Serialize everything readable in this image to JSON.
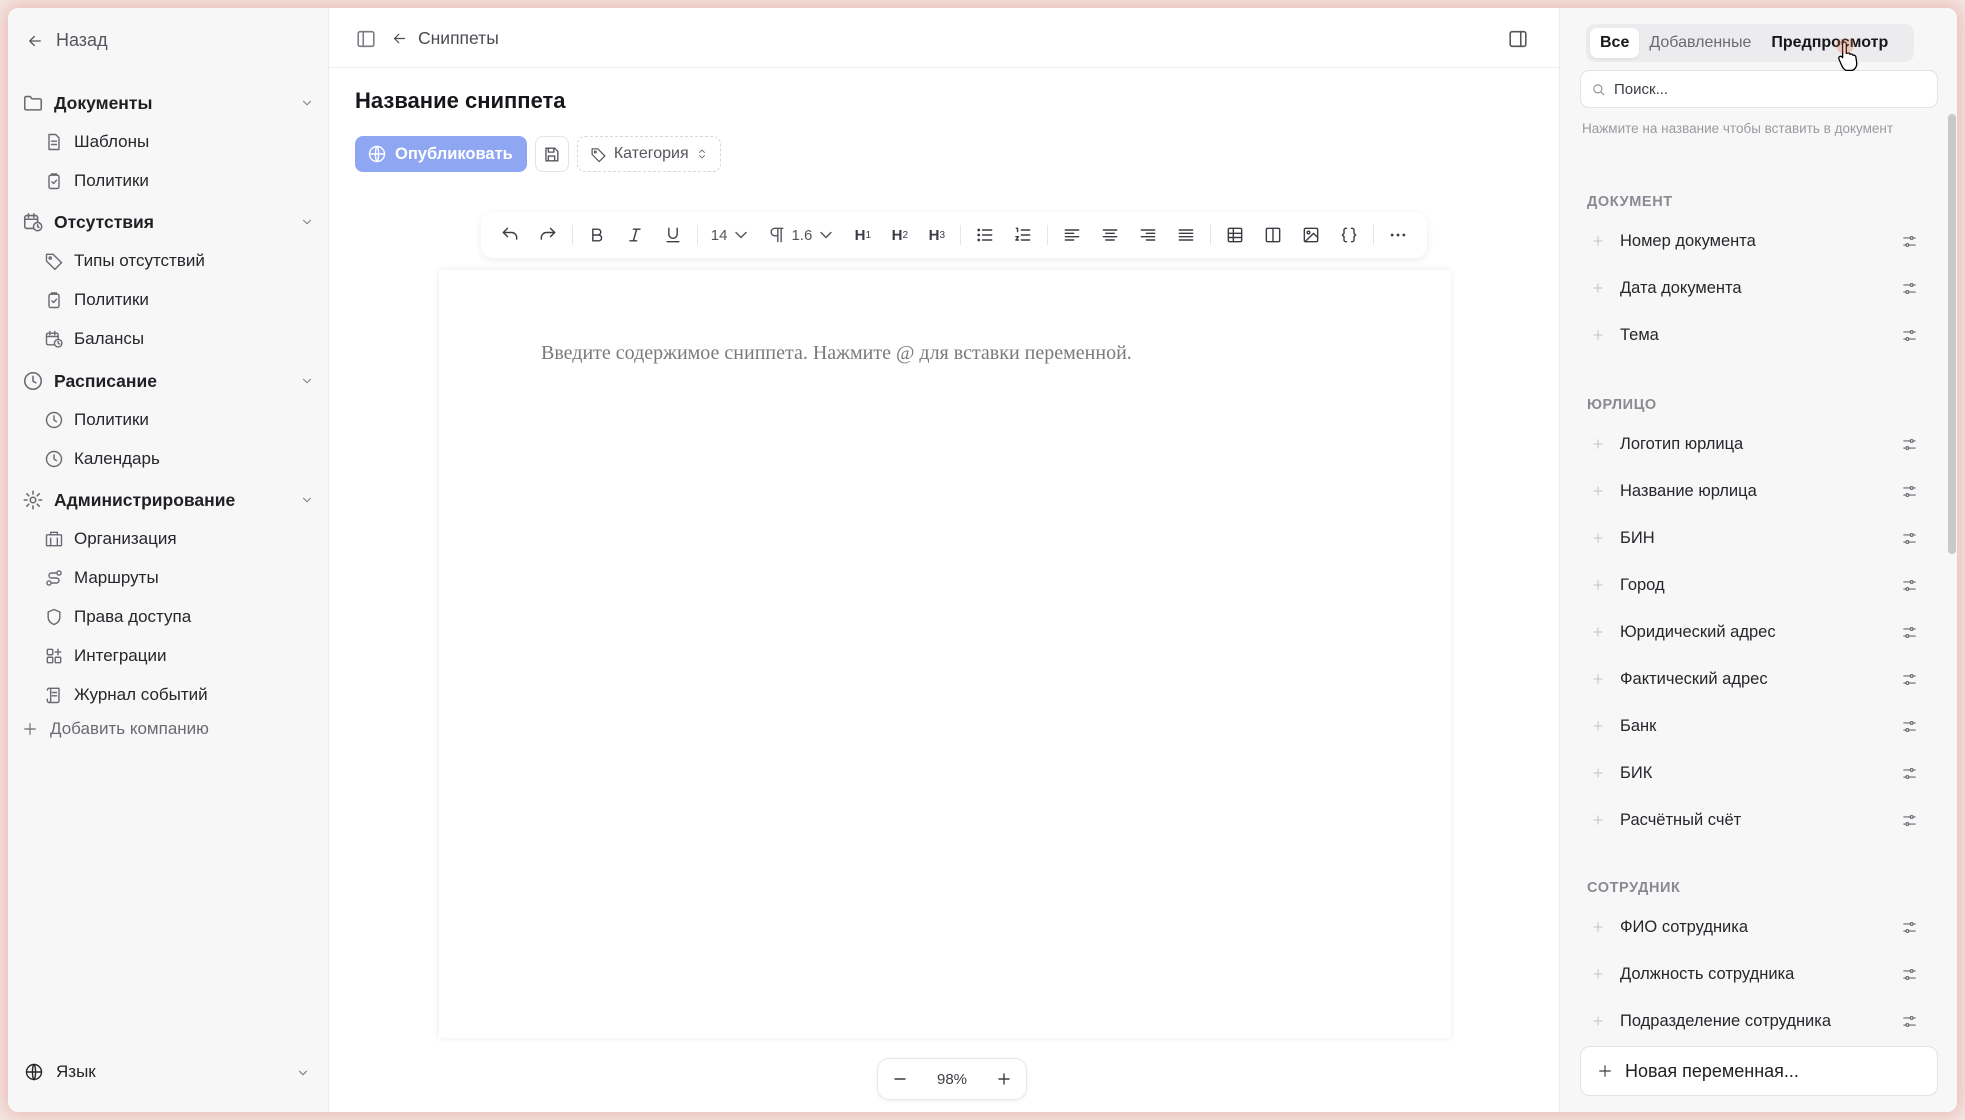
{
  "sidebar": {
    "back_label": "Назад",
    "groups": [
      {
        "label": "Документы",
        "icon": "folder-icon",
        "items": [
          {
            "label": "Шаблоны",
            "icon": "document-icon"
          },
          {
            "label": "Политики",
            "icon": "clipboard-icon"
          }
        ]
      },
      {
        "label": "Отсутствия",
        "icon": "calendar-clock-icon",
        "items": [
          {
            "label": "Типы отсутствий",
            "icon": "tag-icon"
          },
          {
            "label": "Политики",
            "icon": "clipboard-icon"
          },
          {
            "label": "Балансы",
            "icon": "calendar-clock-icon"
          }
        ]
      },
      {
        "label": "Расписание",
        "icon": "clock-icon",
        "items": [
          {
            "label": "Политики",
            "icon": "clock-icon"
          },
          {
            "label": "Календарь",
            "icon": "clock-icon"
          }
        ]
      },
      {
        "label": "Администрирование",
        "icon": "gear-icon",
        "items": [
          {
            "label": "Организация",
            "icon": "building-icon"
          },
          {
            "label": "Маршруты",
            "icon": "route-icon"
          },
          {
            "label": "Права доступа",
            "icon": "shield-icon"
          },
          {
            "label": "Интеграции",
            "icon": "grid-plus-icon"
          },
          {
            "label": "Журнал событий",
            "icon": "log-icon"
          }
        ]
      }
    ],
    "add_company_label": "Добавить компанию",
    "language_label": "Язык"
  },
  "header": {
    "breadcrumb": "Сниппеты",
    "title": "Название сниппета",
    "publish_label": "Опубликовать",
    "category_label": "Категория"
  },
  "toolbar": {
    "font_size": "14",
    "line_height": "1.6",
    "h1": "H",
    "h2": "H",
    "h3": "H"
  },
  "editor": {
    "placeholder": "Введите содержимое сниппета. Нажмите @ для вставки переменной."
  },
  "zoom": {
    "value": "98%"
  },
  "panel": {
    "tabs": [
      "Все",
      "Добавленные",
      "Предпросмотр"
    ],
    "active_tab": 0,
    "search_placeholder": "Поиск...",
    "hint": "Нажмите на название чтобы вставить в документ",
    "sections": [
      {
        "title": "ДОКУМЕНТ",
        "items": [
          "Номер документа",
          "Дата документа",
          "Тема"
        ]
      },
      {
        "title": "ЮРЛИЦО",
        "items": [
          "Логотип юрлица",
          "Название юрлица",
          "БИН",
          "Город",
          "Юридический адрес",
          "Фактический адрес",
          "Банк",
          "БИК",
          "Расчётный счёт"
        ]
      },
      {
        "title": "СОТРУДНИК",
        "items": [
          "ФИО сотрудника",
          "Должность сотрудника",
          "Подразделение сотрудника"
        ]
      }
    ],
    "new_variable_label": "Новая переменная..."
  },
  "colors": {
    "accent": "#8fa6f2",
    "frame_glow": "#d67864"
  }
}
